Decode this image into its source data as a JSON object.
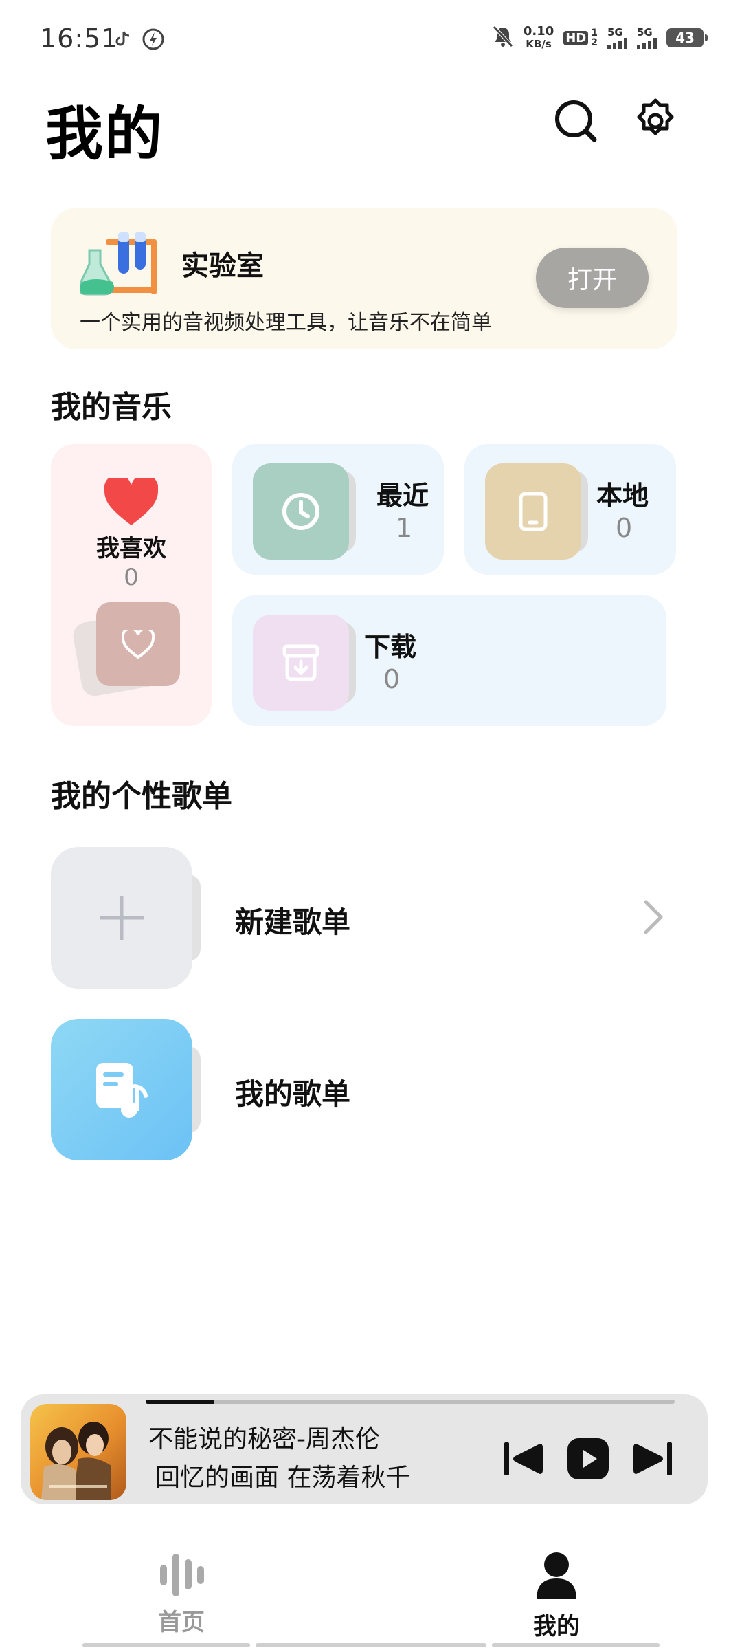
{
  "status_bar": {
    "time": "16:51",
    "net_speed_value": "0.10",
    "net_speed_unit": "KB/s",
    "hd_badge": "HD",
    "sim1": "1",
    "sim2": "2",
    "network1": "5G",
    "network2": "5G",
    "battery": "43"
  },
  "header": {
    "title": "我的",
    "search_icon": "search-icon",
    "settings_icon": "gear-icon"
  },
  "lab": {
    "title": "实验室",
    "description": "一个实用的音视频处理工具，让音乐不在简单",
    "open_label": "打开"
  },
  "my_music": {
    "section_title": "我的音乐",
    "favorites": {
      "label": "我喜欢",
      "count": "0",
      "color": "#f25050"
    },
    "recent": {
      "label": "最近",
      "count": "1"
    },
    "local": {
      "label": "本地",
      "count": "0"
    },
    "download": {
      "label": "下载",
      "count": "0"
    }
  },
  "playlists": {
    "section_title": "我的个性歌单",
    "items": [
      {
        "label": "新建歌单"
      },
      {
        "label": "我的歌单"
      }
    ]
  },
  "player": {
    "song": "不能说的秘密-周杰伦",
    "lyric": "回忆的画面 在荡着秋千",
    "progress": 0.13
  },
  "nav": {
    "items": [
      {
        "label": "首页",
        "active": false
      },
      {
        "label": "我的",
        "active": true
      }
    ]
  },
  "colors": {
    "accent_dark": "#111111",
    "lab_bg": "#fdf8ec",
    "fav_bg": "#fff0f1",
    "tile_bg": "#edf5fd"
  }
}
